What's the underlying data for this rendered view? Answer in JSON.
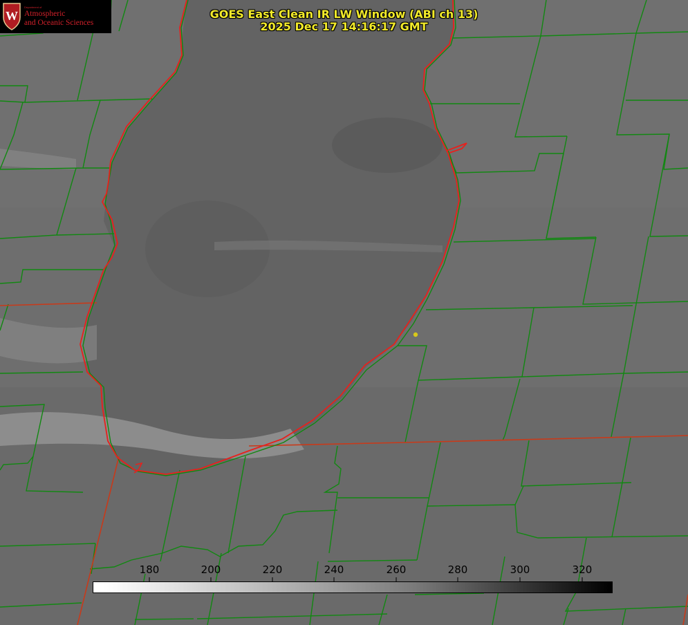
{
  "title": {
    "line1": "GOES East Clean IR LW Window (ABI ch 13)",
    "line2": "2025 Dec 17 14:16:17 GMT"
  },
  "logo": {
    "department": "Department of",
    "line1": "Atmospheric",
    "line2": "and Oceanic Sciences",
    "crest_letter": "W"
  },
  "colorbar": {
    "ticks": [
      "180",
      "200",
      "220",
      "240",
      "260",
      "280",
      "300",
      "320"
    ],
    "range": [
      168,
      331
    ],
    "gradient": "white (cold) to black (warm)"
  },
  "colors": {
    "title": "#f2ea2a",
    "county_lines": "#118811",
    "state_lines": "#c83a1a",
    "shoreline": "#e8201c",
    "marker": "#d8c81a",
    "logo_text": "#d0202a",
    "background_gray": "#6f6f6f"
  },
  "map": {
    "marker": "station-dot",
    "features": [
      "lake",
      "county-boundaries",
      "state-boundaries",
      "shoreline"
    ]
  }
}
